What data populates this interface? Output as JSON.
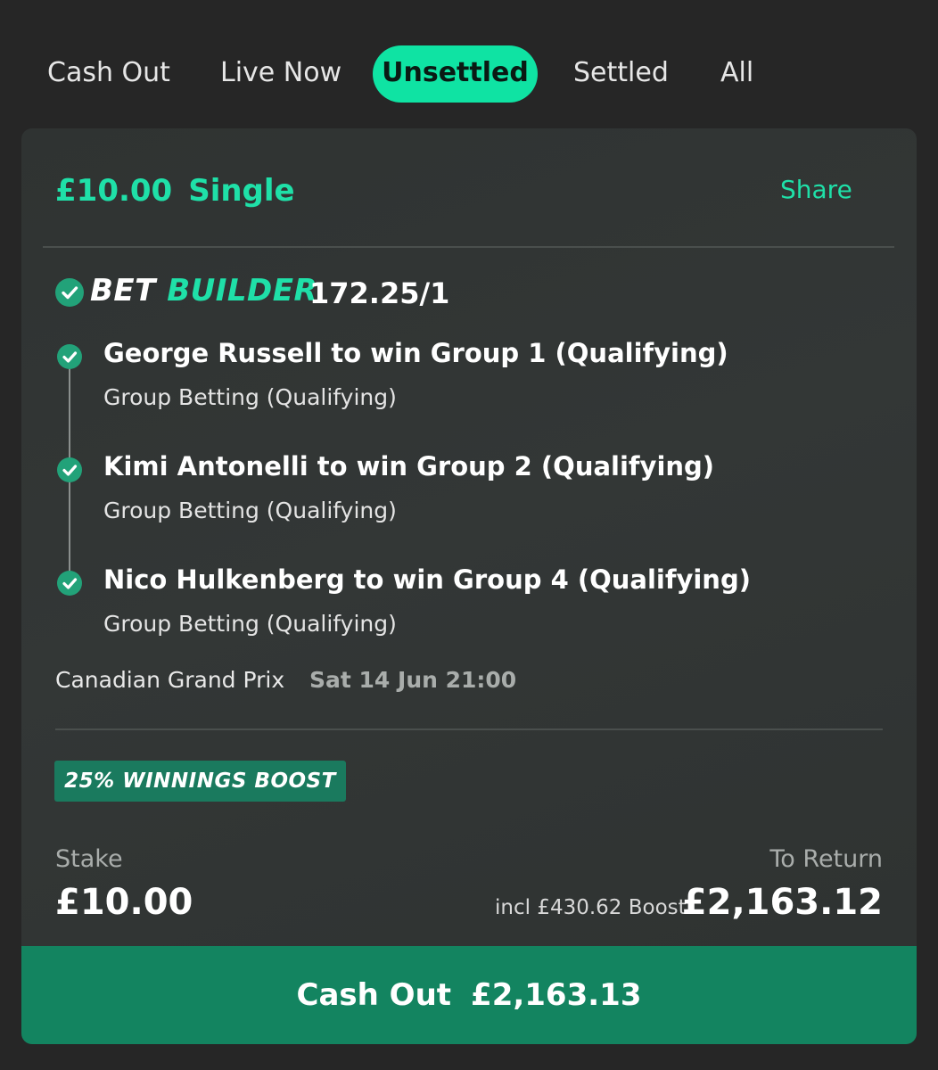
{
  "tabs": {
    "cash_out": "Cash Out",
    "live_now": "Live Now",
    "unsettled": "Unsettled",
    "settled": "Settled",
    "all": "All",
    "active": "Unsettled"
  },
  "bet": {
    "stake_header": "£10.00",
    "type": "Single",
    "share_label": "Share",
    "builder_label_white": "BET",
    "builder_label_green": "BUILDER",
    "odds": "172.25/1",
    "legs": [
      {
        "selection": "George Russell to win Group 1 (Qualifying)",
        "market": "Group Betting (Qualifying)"
      },
      {
        "selection": "Kimi Antonelli to win Group 2 (Qualifying)",
        "market": "Group Betting (Qualifying)"
      },
      {
        "selection": "Nico Hulkenberg to win Group 4 (Qualifying)",
        "market": "Group Betting (Qualifying)"
      }
    ],
    "event_name": "Canadian Grand Prix",
    "event_time": "Sat 14 Jun 21:00",
    "boost_badge": "25% WINNINGS BOOST",
    "stake_label": "Stake",
    "stake_value": "£10.00",
    "return_label": "To Return",
    "boost_incl": "incl £430.62 Boost",
    "return_value": "£2,163.12",
    "cashout_label": "Cash Out",
    "cashout_value": "£2,163.13"
  },
  "colors": {
    "accent": "#0fe3a3",
    "accent_text": "#1fe0a8",
    "check": "#22a279",
    "cashout_bg": "#138460",
    "boost_bg": "#1a7a5e",
    "background": "#262626",
    "card": "#313534"
  },
  "icons": {
    "check": "check-circle-icon"
  }
}
